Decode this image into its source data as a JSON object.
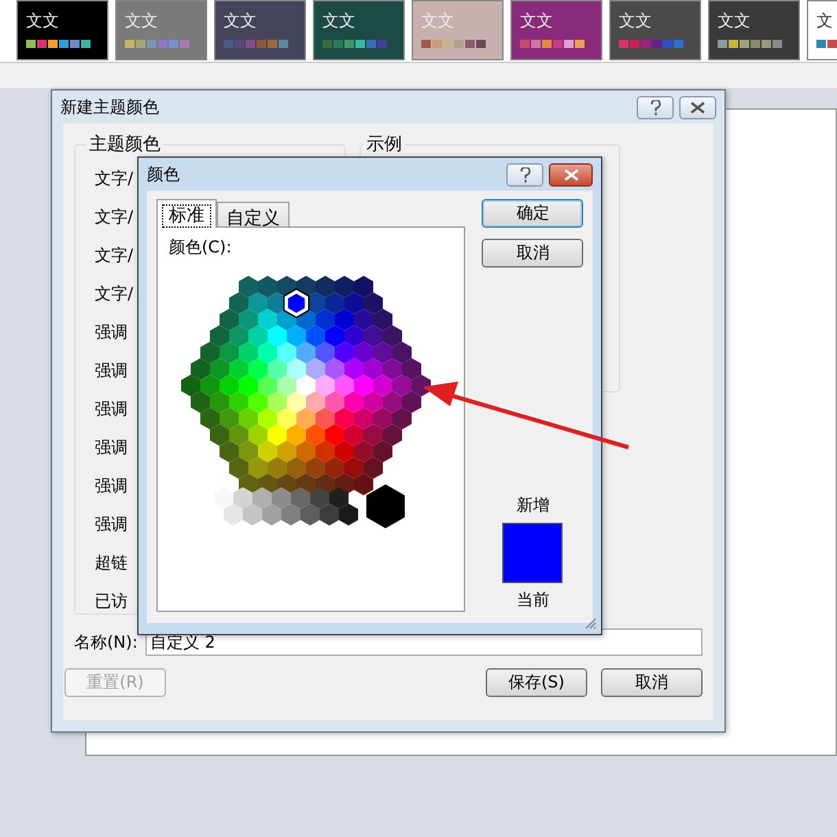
{
  "theme_gallery": [
    {
      "label": "文文",
      "color": "#000000",
      "swatches": [
        {
          "color": "#8cc152"
        },
        {
          "color": "#d9326e"
        },
        {
          "color": "#f0a02c"
        },
        {
          "color": "#2aa0d8"
        },
        {
          "color": "#6b8cc8"
        },
        {
          "color": "#3cb4a0"
        }
      ]
    },
    {
      "label": "文文",
      "color": "#7a7a7a",
      "swatches": [
        {
          "color": "#c8b464"
        },
        {
          "color": "#a0a878"
        },
        {
          "color": "#7896b4"
        },
        {
          "color": "#8c78c8"
        },
        {
          "color": "#7890c8"
        },
        {
          "color": "#a87ab4"
        }
      ]
    },
    {
      "label": "文文",
      "color": "#44445a",
      "swatches": [
        {
          "color": "#4a5a8a"
        },
        {
          "color": "#5a4a7a"
        },
        {
          "color": "#8a4a8a"
        },
        {
          "color": "#8a5a3a"
        },
        {
          "color": "#9a6a3a"
        },
        {
          "color": "#5a8a9a"
        }
      ]
    },
    {
      "label": "文文",
      "color": "#1c4a44",
      "swatches": [
        {
          "color": "#3a6a3a"
        },
        {
          "color": "#2a7a5a"
        },
        {
          "color": "#3a9a6a"
        },
        {
          "color": "#3abaa0"
        },
        {
          "color": "#3a6aba"
        },
        {
          "color": "#4a3a9a"
        }
      ]
    },
    {
      "label": "文文",
      "color": "#c8b0b0",
      "swatches": [
        {
          "color": "#a05a4a"
        },
        {
          "color": "#c8a070"
        },
        {
          "color": "#c8b48c"
        },
        {
          "color": "#b4a08c"
        },
        {
          "color": "#8c5a6a"
        },
        {
          "color": "#6a4a5a"
        }
      ]
    },
    {
      "label": "文文",
      "color": "#8a2a7a",
      "swatches": [
        {
          "color": "#c84a6a"
        },
        {
          "color": "#c878a0"
        },
        {
          "color": "#e08a3a"
        },
        {
          "color": "#c83a8a"
        },
        {
          "color": "#e0a0c8"
        },
        {
          "color": "#f0a050"
        }
      ]
    },
    {
      "label": "文文",
      "color": "#4a4a4a",
      "swatches": [
        {
          "color": "#e0306a"
        },
        {
          "color": "#c82060"
        },
        {
          "color": "#a02080"
        },
        {
          "color": "#6a2090"
        },
        {
          "color": "#2a50c8"
        },
        {
          "color": "#2a70d0"
        }
      ]
    },
    {
      "label": "文文",
      "color": "#3a3a3a",
      "swatches": [
        {
          "color": "#8a9aa0"
        },
        {
          "color": "#c8b43a"
        },
        {
          "color": "#a0a070"
        },
        {
          "color": "#8a8a6a"
        },
        {
          "color": "#9a9a7a"
        },
        {
          "color": "#8a8a8a"
        }
      ]
    },
    {
      "label": "文",
      "color": "#ffffff",
      "swatches": [
        {
          "color": "#2a8ab4"
        },
        {
          "color": "#c84a4a"
        }
      ]
    }
  ],
  "theme_dialog": {
    "title": "新建主题颜色",
    "theme_colors": {
      "title": "主题颜色",
      "items": [
        "文字/",
        "文字/",
        "文字/",
        "文字/",
        "强调",
        "强调",
        "强调",
        "强调",
        "强调",
        "强调",
        "超链",
        "已访"
      ]
    },
    "sample": {
      "title": "示例"
    },
    "name": {
      "label": "名称(N):",
      "value": "自定义 2"
    },
    "buttons": [
      {
        "label": "重置(R)",
        "disabled": true
      },
      {
        "label": "保存(S)",
        "disabled": false
      },
      {
        "label": "取消",
        "disabled": false
      }
    ]
  },
  "color_dialog": {
    "title": "颜色",
    "tabs": [
      {
        "label": "标准",
        "selected": true
      },
      {
        "label": "自定义",
        "selected": false
      }
    ],
    "palette_label": "颜色(C):",
    "buttons": [
      "确定",
      "取消"
    ],
    "new_label": "新增",
    "new_swatch": {
      "color": "#0000ff"
    },
    "current_label": "当前"
  }
}
